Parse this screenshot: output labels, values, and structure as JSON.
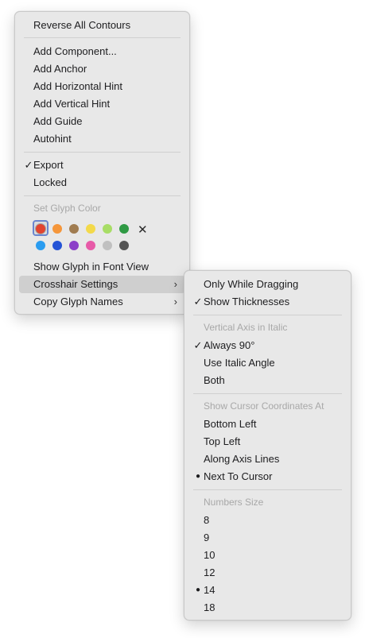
{
  "main_menu": {
    "reverse_contours": "Reverse All Contours",
    "add_component": "Add Component...",
    "add_anchor": "Add Anchor",
    "add_horizontal_hint": "Add Horizontal Hint",
    "add_vertical_hint": "Add Vertical Hint",
    "add_guide": "Add Guide",
    "autohint": "Autohint",
    "export": "Export",
    "export_checked": "✓",
    "locked": "Locked",
    "glyph_color_header": "Set Glyph Color",
    "colors": [
      "#e2442f",
      "#f5963a",
      "#a07c50",
      "#f3d94a",
      "#a8dd66",
      "#2f9a44",
      "#2a9cf0",
      "#2453d6",
      "#8b3fc8",
      "#e75aa8",
      "#c0c0c0",
      "#555555"
    ],
    "clear_color": "✕",
    "show_in_font_view": "Show Glyph in Font View",
    "crosshair_settings": "Crosshair Settings",
    "copy_glyph_names": "Copy Glyph Names",
    "submenu_arrow": "›"
  },
  "submenu": {
    "only_while_dragging": "Only While Dragging",
    "show_thicknesses": "Show Thicknesses",
    "check": "✓",
    "bullet": "●",
    "vertical_axis_header": "Vertical Axis in Italic",
    "always_90": "Always 90°",
    "use_italic_angle": "Use Italic Angle",
    "both": "Both",
    "coords_header": "Show Cursor Coordinates At",
    "bottom_left": "Bottom Left",
    "top_left": "Top Left",
    "along_axis_lines": "Along Axis Lines",
    "next_to_cursor": "Next To Cursor",
    "numbers_size_header": "Numbers Size",
    "sizes": [
      "8",
      "9",
      "10",
      "12",
      "14",
      "18"
    ]
  }
}
